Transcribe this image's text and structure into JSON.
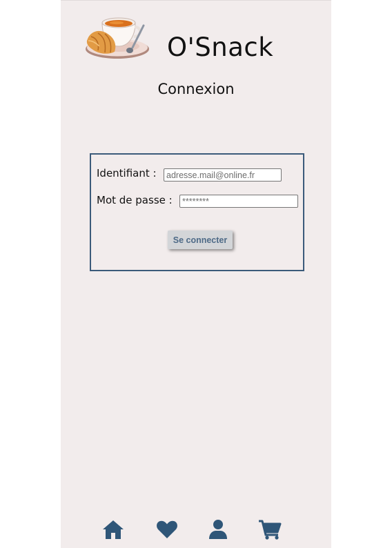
{
  "header": {
    "brand": "O'Snack",
    "logo_icon": "tea-croissant-logo"
  },
  "page": {
    "title": "Connexion"
  },
  "form": {
    "identifier_label": "Identifiant :",
    "identifier_placeholder": "adresse.mail@online.fr",
    "identifier_value": "",
    "password_label": "Mot de passe :",
    "password_placeholder": "********",
    "password_value": "",
    "submit_label": "Se connecter"
  },
  "nav": {
    "items": [
      {
        "icon": "home-icon"
      },
      {
        "icon": "heart-icon"
      },
      {
        "icon": "user-icon"
      },
      {
        "icon": "cart-icon"
      }
    ]
  },
  "colors": {
    "app_background": "#f2ecec",
    "accent": "#2f5678",
    "box_border": "#3b5a7a",
    "button_background": "#d3d5d8",
    "button_text": "#4e6a87"
  }
}
